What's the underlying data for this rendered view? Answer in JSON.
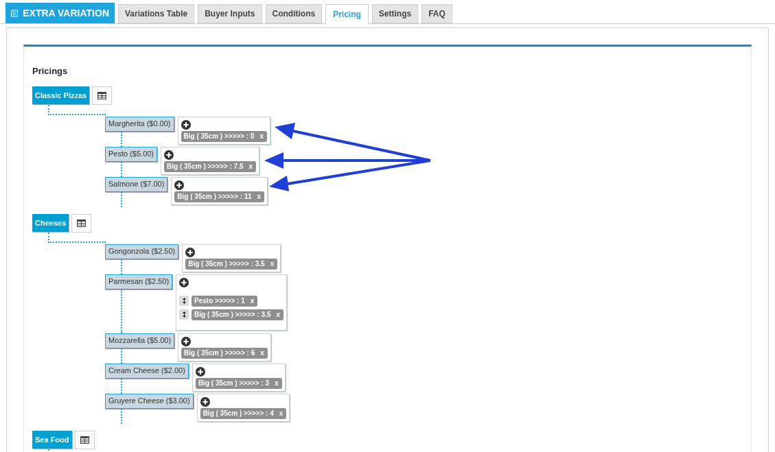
{
  "header": {
    "title": "EXTRA VARIATION"
  },
  "tabs": [
    {
      "label": "Variations Table",
      "selected": false
    },
    {
      "label": "Buyer Inputs",
      "selected": false
    },
    {
      "label": "Conditions",
      "selected": false
    },
    {
      "label": "Pricing",
      "selected": true
    },
    {
      "label": "Settings",
      "selected": false
    },
    {
      "label": "FAQ",
      "selected": false
    }
  ],
  "section_title": "Pricings",
  "categories": [
    {
      "label": "Classic Pizzas",
      "items": [
        {
          "label": "Margherita ($0.00)",
          "sortable": false,
          "rules": [
            {
              "text": "Big ( 35cm ) >>>>> : 0",
              "remove": "x"
            }
          ]
        },
        {
          "label": "Pesto ($5.00)",
          "sortable": false,
          "rules": [
            {
              "text": "Big ( 35cm ) >>>>> : 7.5",
              "remove": "x"
            }
          ]
        },
        {
          "label": "Salmone ($7.00)",
          "sortable": false,
          "rules": [
            {
              "text": "Big ( 35cm ) >>>>> : 11",
              "remove": "x"
            }
          ]
        }
      ]
    },
    {
      "label": "Cheeses",
      "items": [
        {
          "label": "Gongonzola ($2.50)",
          "sortable": false,
          "rules": [
            {
              "text": "Big ( 35cm ) >>>>> : 3.5",
              "remove": "x"
            }
          ]
        },
        {
          "label": "Parmesan ($2.50)",
          "sortable": true,
          "rules": [
            {
              "text": "Pesto >>>>> : 1",
              "remove": "x"
            },
            {
              "text": "Big ( 35cm ) >>>>> : 3.5",
              "remove": "x"
            }
          ]
        },
        {
          "label": "Mozzarella ($5.00)",
          "sortable": false,
          "rules": [
            {
              "text": "Big ( 35cm ) >>>>> : 6",
              "remove": "x"
            }
          ]
        },
        {
          "label": "Cream Cheese ($2.00)",
          "sortable": false,
          "rules": [
            {
              "text": "Big ( 35cm ) >>>>> : 3",
              "remove": "x"
            }
          ]
        },
        {
          "label": "Gruyere Cheese ($3.00)",
          "sortable": false,
          "rules": [
            {
              "text": "Big ( 35cm ) >>>>> : 4",
              "remove": "x"
            }
          ]
        }
      ]
    },
    {
      "label": "Sea Food"
    }
  ]
}
